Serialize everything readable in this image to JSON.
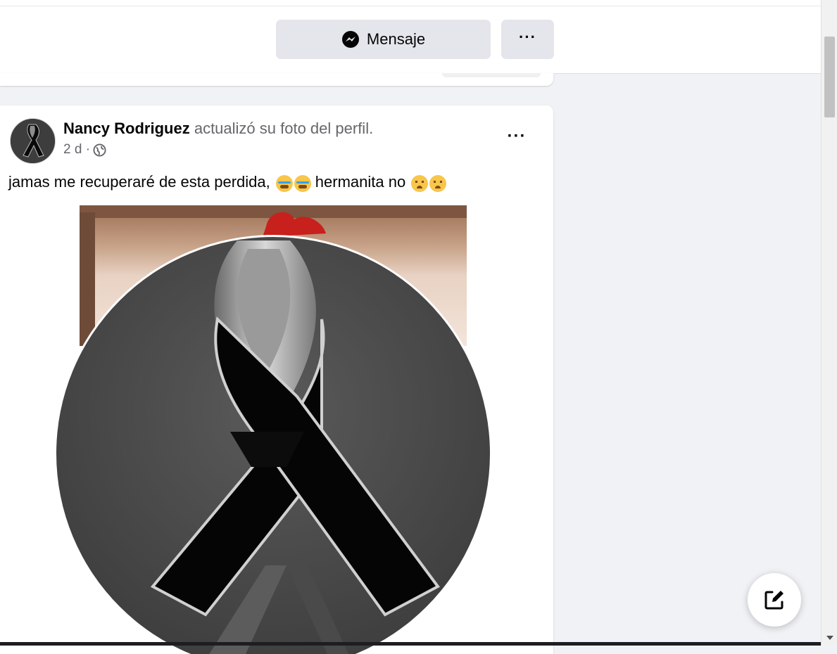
{
  "toolbar": {
    "message_label": "Mensaje",
    "more_label": "···"
  },
  "post": {
    "author_name": "Nancy Rodriguez",
    "action_text": "actualizó su foto del perfil.",
    "time": "2 d ·",
    "privacy_icon": "globe-icon",
    "more_label": "···",
    "caption_text_1": "jamas me recuperaré de esta perdida,",
    "caption_text_2": "hermanita no",
    "caption_emojis_1": [
      "crying-face",
      "crying-face"
    ],
    "caption_emojis_2": [
      "sad-face",
      "sad-face"
    ]
  },
  "colors": {
    "page_bg": "#f0f2f5",
    "button_bg": "#e4e6eb",
    "secondary_text": "#65676b"
  },
  "icons": [
    "messenger-icon",
    "globe-icon",
    "more-dots-icon",
    "compose-icon",
    "black-ribbon-image"
  ]
}
